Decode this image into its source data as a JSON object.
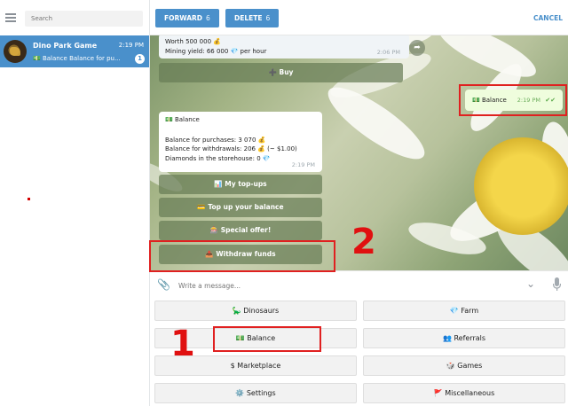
{
  "sidebar": {
    "search_placeholder": "Search",
    "chat": {
      "name": "Dino Park Game",
      "time": "2:19 PM",
      "preview": "💵 Balance  Balance for pu...",
      "unread": "1"
    }
  },
  "topbar": {
    "forward_label": "FORWARD",
    "forward_count": "6",
    "delete_label": "DELETE",
    "delete_count": "6",
    "cancel_label": "CANCEL"
  },
  "messages": {
    "msg1_line1": "Worth 500 000 💰",
    "msg1_line2": "Mining yield: 66 000 💎 per hour",
    "msg1_time": "2:06 PM",
    "buy_button": "➕ Buy",
    "outgoing_text": "💵 Balance",
    "outgoing_time": "2:19 PM",
    "outgoing_check": "✔✔",
    "balance_title": "💵 Balance",
    "balance_line1": "Balance for purchases: 3 070 💰",
    "balance_line2": "Balance for withdrawals: 206 💰 (~ $1.00)",
    "balance_line3": "Diamonds in the storehouse: 0 💎",
    "balance_time": "2:19 PM",
    "inline_buttons": [
      "📊 My top-ups",
      "💳 Top up your balance",
      "🎰 Special offer!",
      "📤 Withdraw funds"
    ]
  },
  "composer": {
    "placeholder": "Write a message..."
  },
  "reply_keyboard": {
    "buttons": [
      "🦕 Dinosaurs",
      "💎 Farm",
      "💵 Balance",
      "👥 Referrals",
      "$ Marketplace",
      "🎲 Games",
      "⚙️ Settings",
      "🚩 Miscellaneous"
    ]
  },
  "annotations": {
    "label_1": "1",
    "label_2": "2",
    "color": "#e02020"
  },
  "colors": {
    "accent": "#4a90cb",
    "selected_chat_bg": "#4a90cb",
    "outgoing_bubble": "#effddd",
    "inline_button_bg": "#687d56"
  }
}
